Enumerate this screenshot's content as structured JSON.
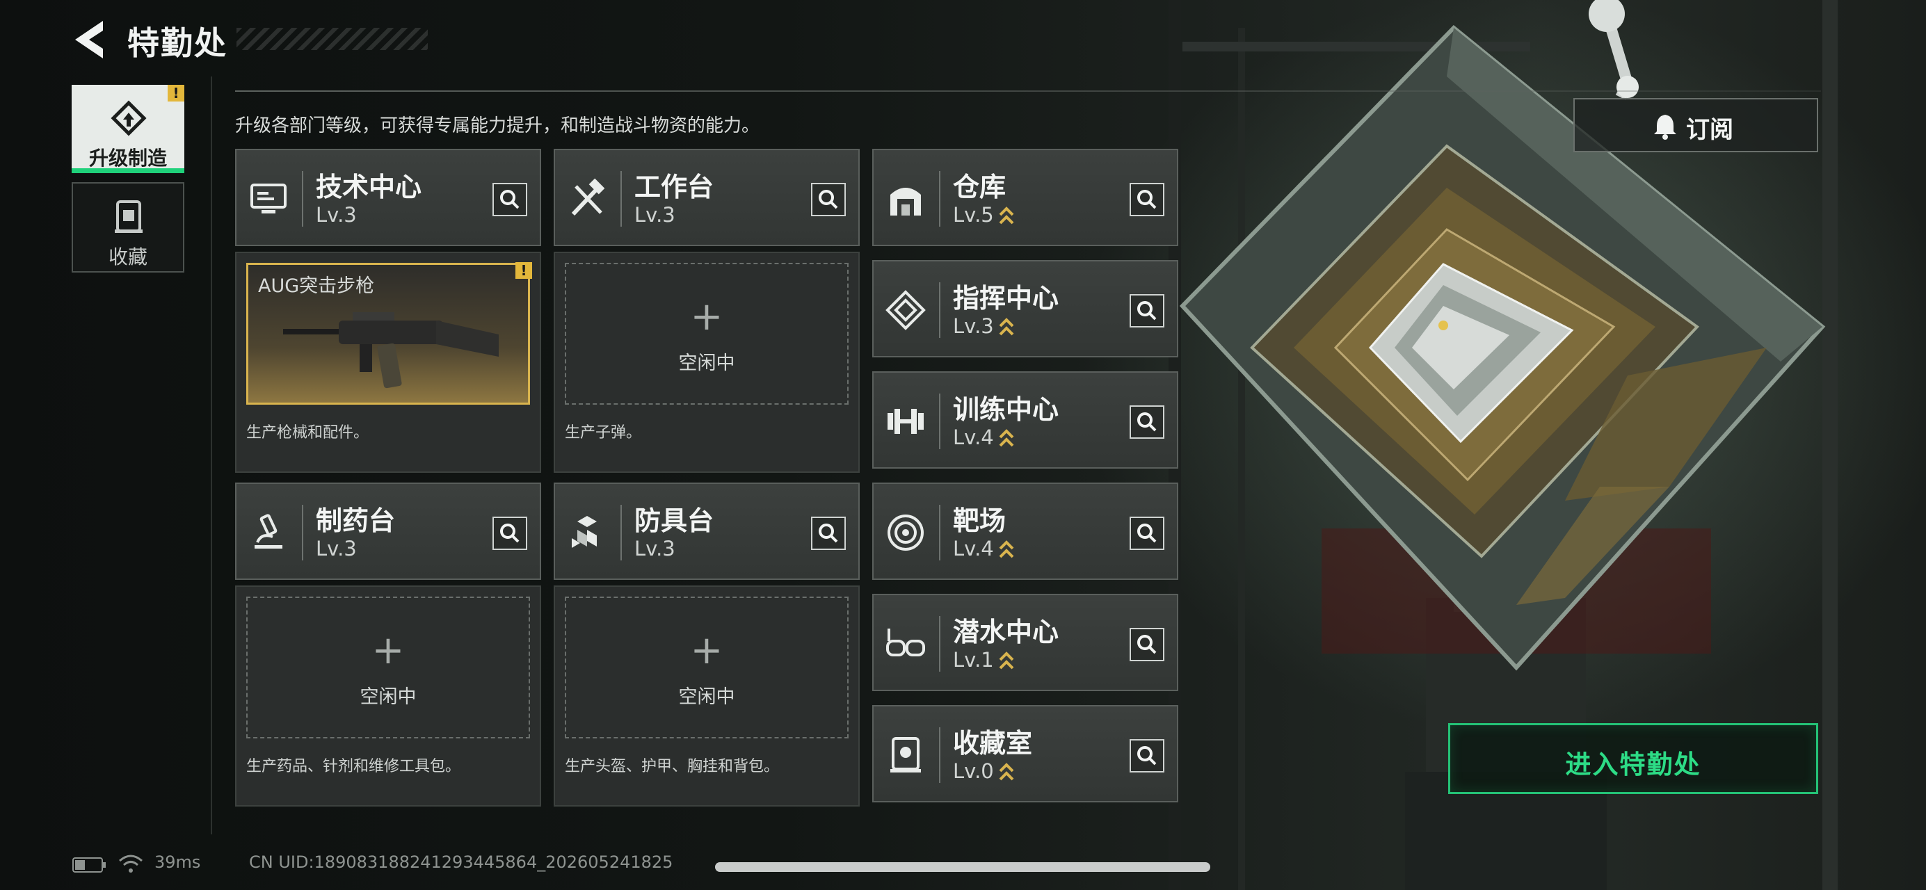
{
  "header": {
    "title": "特勤处"
  },
  "side_tabs": [
    {
      "label": "升级制造",
      "active": true,
      "badge": "!",
      "icon": "upgrade-craft-icon"
    },
    {
      "label": "收藏",
      "active": false,
      "icon": "collection-icon"
    }
  ],
  "subtitle": "升级各部门等级，可获得专属能力提升，和制造战斗物资的能力。",
  "workshops": [
    {
      "name": "技术中心",
      "level": "Lv.3",
      "icon": "computer-icon",
      "slot_state": "filled",
      "slot_item": "AUG突击步枪",
      "slot_badge": "!",
      "description": "生产枪械和配件。"
    },
    {
      "name": "工作台",
      "level": "Lv.3",
      "icon": "tools-icon",
      "slot_state": "idle",
      "slot_status": "空闲中",
      "description": "生产子弹。"
    },
    {
      "name": "制药台",
      "level": "Lv.3",
      "icon": "microscope-icon",
      "slot_state": "idle",
      "slot_status": "空闲中",
      "description": "生产药品、针剂和维修工具包。"
    },
    {
      "name": "防具台",
      "level": "Lv.3",
      "icon": "armor-blocks-icon",
      "slot_state": "idle",
      "slot_status": "空闲中",
      "description": "生产头盔、护甲、胸挂和背包。"
    }
  ],
  "facilities": [
    {
      "name": "仓库",
      "level": "Lv.5",
      "icon": "warehouse-icon",
      "upgradable": true
    },
    {
      "name": "指挥中心",
      "level": "Lv.3",
      "icon": "command-diamond-icon",
      "upgradable": true
    },
    {
      "name": "训练中心",
      "level": "Lv.4",
      "icon": "dumbbell-icon",
      "upgradable": true
    },
    {
      "name": "靶场",
      "level": "Lv.4",
      "icon": "target-icon",
      "upgradable": true
    },
    {
      "name": "潜水中心",
      "level": "Lv.1",
      "icon": "diving-goggles-icon",
      "upgradable": true
    },
    {
      "name": "收藏室",
      "level": "Lv.0",
      "icon": "trophy-case-icon",
      "upgradable": true
    }
  ],
  "subscribe_label": "订阅",
  "enter_label": "进入特勤处",
  "status_bar": {
    "ping": "39ms",
    "uid": "CN UID:18908318824129344586­4_202605241825"
  },
  "colors": {
    "accent_green": "#1fd17a",
    "badge_yellow": "#e3b73b",
    "level_arrow": "#d9b44e"
  }
}
